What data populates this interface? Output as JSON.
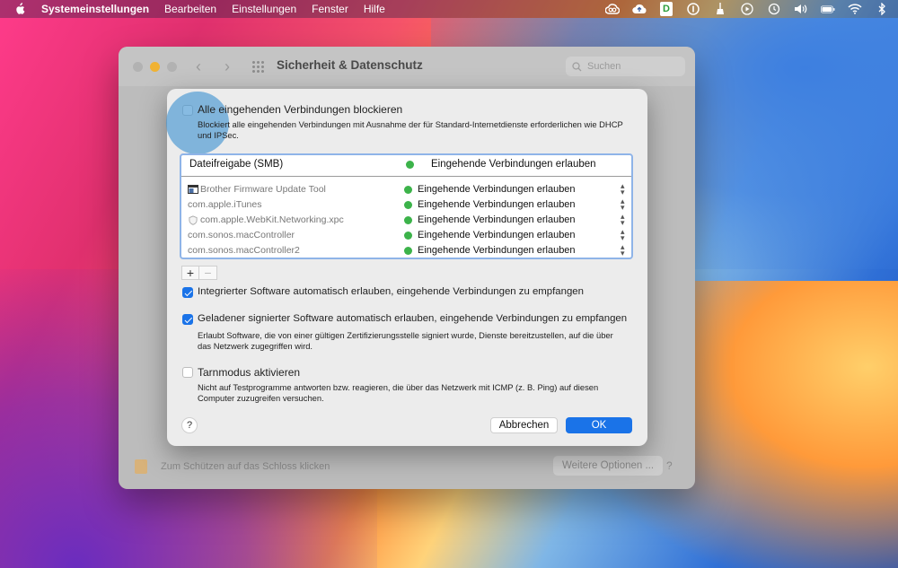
{
  "menubar": {
    "app_name": "Systemeinstellungen",
    "items": [
      "Bearbeiten",
      "Einstellungen",
      "Fenster",
      "Hilfe"
    ],
    "status_icons": [
      "creative-cloud-icon",
      "cloud-upload-icon",
      "dash-icon",
      "onepassword-icon",
      "broom-icon",
      "play-icon",
      "time-machine-icon",
      "volume-icon",
      "battery-icon",
      "wifi-icon",
      "bluetooth-icon"
    ],
    "dash_letter": "D"
  },
  "pref_window": {
    "title": "Sicherheit & Datenschutz",
    "search_placeholder": "Suchen",
    "lock_text": "Zum Schützen auf das Schloss klicken",
    "more_options": "Weitere Optionen ...",
    "help": "?"
  },
  "sheet": {
    "block_all": {
      "label": "Alle eingehenden Verbindungen blockieren",
      "description": "Blockiert alle eingehenden Verbindungen mit Ausnahme der für Standard-Internetdienste erforderlichen wie DHCP und IPSec.",
      "checked": false
    },
    "list": {
      "header": {
        "name": "Dateifreigabe (SMB)",
        "status": "Eingehende Verbindungen erlauben"
      },
      "rows": [
        {
          "name": "Brother Firmware Update Tool",
          "status": "Eingehende Verbindungen erlauben",
          "icon": "app-window-icon"
        },
        {
          "name": "com.apple.iTunes",
          "status": "Eingehende Verbindungen erlauben",
          "icon": ""
        },
        {
          "name": "com.apple.WebKit.Networking.xpc",
          "status": "Eingehende Verbindungen erlauben",
          "icon": "shield-icon"
        },
        {
          "name": "com.sonos.macController",
          "status": "Eingehende Verbindungen erlauben",
          "icon": ""
        },
        {
          "name": "com.sonos.macController2",
          "status": "Eingehende Verbindungen erlauben",
          "icon": ""
        }
      ],
      "add": "+",
      "remove": "−"
    },
    "builtin": {
      "label": "Integrierter Software automatisch erlauben, eingehende Verbindungen zu empfangen",
      "checked": true
    },
    "signed": {
      "label": "Geladener signierter Software automatisch erlauben, eingehende Verbindungen zu empfangen",
      "description": "Erlaubt Software, die von einer gültigen Zertifizierungsstelle signiert wurde, Dienste bereitzustellen, auf die über das Netzwerk zugegriffen wird.",
      "checked": true
    },
    "stealth": {
      "label": "Tarnmodus aktivieren",
      "description": "Nicht auf Testprogramme antworten bzw. reagieren, die über das Netzwerk mit ICMP (z. B. Ping) auf diesen Computer zuzugreifen versuchen.",
      "checked": false
    },
    "help": "?",
    "cancel": "Abbrechen",
    "ok": "OK"
  },
  "colors": {
    "accent": "#1a73e8",
    "status_green": "#3cb34a",
    "list_focus": "#8fb4e8"
  }
}
